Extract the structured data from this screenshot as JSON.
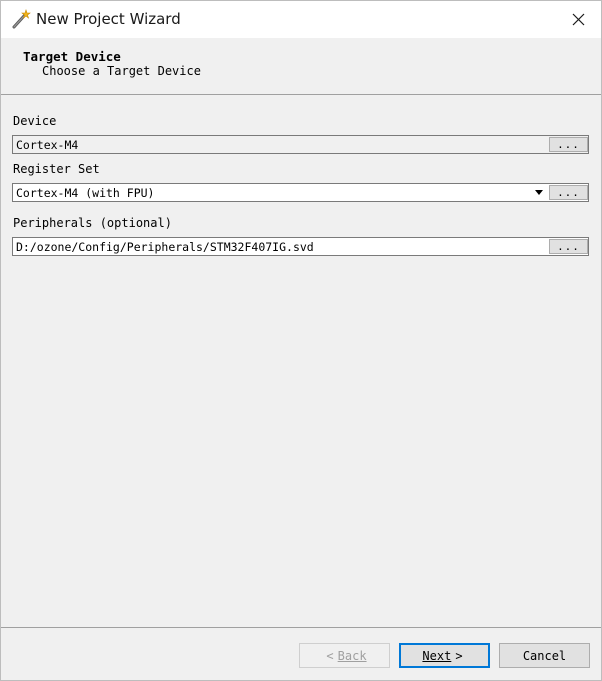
{
  "window": {
    "title": "New Project Wizard",
    "icon": "magic-wand-icon",
    "close_glyph": "✕"
  },
  "header": {
    "title": "Target Device",
    "subtitle": "Choose a Target Device"
  },
  "fields": {
    "device": {
      "label": "Device",
      "value": "Cortex-M4",
      "browse_label": "..."
    },
    "register_set": {
      "label": "Register Set",
      "value": "Cortex-M4 (with FPU)",
      "browse_label": "..."
    },
    "peripherals": {
      "label": "Peripherals (optional)",
      "value": "D:/ozone/Config/Peripherals/STM32F407IG.svd",
      "browse_label": "..."
    }
  },
  "footer": {
    "back": {
      "label": "Back",
      "prefix": "<",
      "enabled": false
    },
    "next": {
      "label": "Next",
      "suffix": ">",
      "enabled": true
    },
    "cancel": {
      "label": "Cancel"
    }
  },
  "colors": {
    "background": "#f0f0f0",
    "titlebar": "#ffffff",
    "default_button_border": "#0078d7",
    "disabled_text": "#a0a0a0"
  }
}
